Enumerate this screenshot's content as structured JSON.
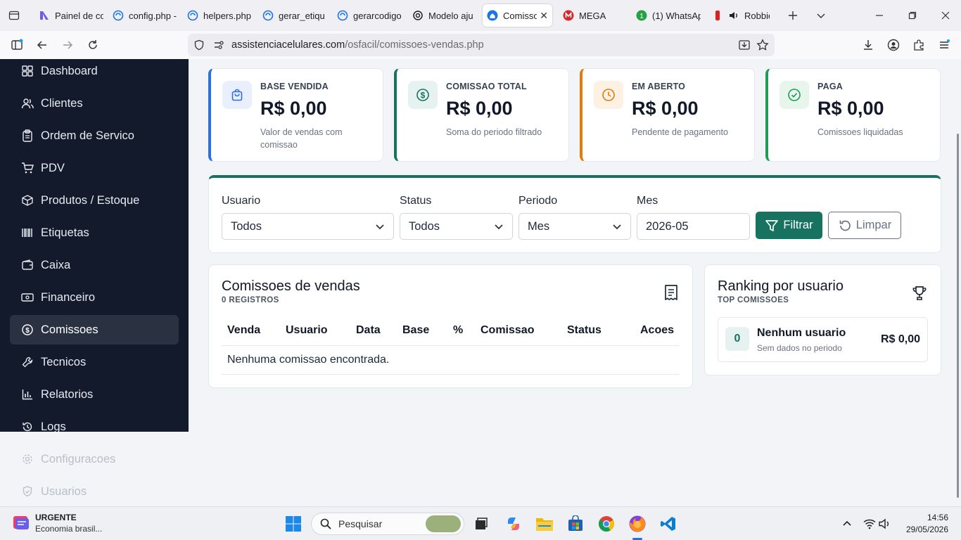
{
  "browser": {
    "tabs": [
      {
        "label": "Painel de co",
        "icon": "php-blue-icon"
      },
      {
        "label": "config.php -",
        "icon": "globe-icon"
      },
      {
        "label": "helpers.php",
        "icon": "globe-icon"
      },
      {
        "label": "gerar_etiqu",
        "icon": "globe-icon"
      },
      {
        "label": "gerarcodigo",
        "icon": "globe-icon"
      },
      {
        "label": "Modelo aju",
        "icon": "openai-icon"
      },
      {
        "label": "Comissoe",
        "icon": "home-icon"
      },
      {
        "label": "MEGA",
        "icon": "mega-icon"
      },
      {
        "label": "(1) WhatsAp",
        "icon": "whatsapp-icon"
      },
      {
        "label": "Robbie",
        "icon": "music-icon"
      }
    ],
    "url_host": "assistenciacelulares.com",
    "url_path": "/osfacil/comissoes-vendas.php"
  },
  "sidebar": {
    "items": [
      {
        "label": "Dashboard",
        "icon": "grid-icon"
      },
      {
        "label": "Clientes",
        "icon": "users-icon"
      },
      {
        "label": "Ordem de Servico",
        "icon": "clipboard-icon"
      },
      {
        "label": "PDV",
        "icon": "cart-icon"
      },
      {
        "label": "Produtos / Estoque",
        "icon": "box-icon"
      },
      {
        "label": "Etiquetas",
        "icon": "barcode-icon"
      },
      {
        "label": "Caixa",
        "icon": "wallet-icon"
      },
      {
        "label": "Financeiro",
        "icon": "cash-icon"
      },
      {
        "label": "Comissoes",
        "icon": "coin-icon",
        "active": true
      },
      {
        "label": "Tecnicos",
        "icon": "wrench-icon"
      },
      {
        "label": "Relatorios",
        "icon": "bar-chart-icon"
      },
      {
        "label": "Logs",
        "icon": "history-icon"
      }
    ],
    "overflow_items": [
      {
        "label": "Configuracoes",
        "icon": "gear-icon"
      },
      {
        "label": "Usuarios",
        "icon": "shield-icon"
      }
    ]
  },
  "stats": [
    {
      "title": "BASE VENDIDA",
      "value": "R$ 0,00",
      "subtitle": "Valor de vendas com comissao",
      "accent": "#2f6fe0",
      "icon": "bag-icon"
    },
    {
      "title": "COMISSAO TOTAL",
      "value": "R$ 0,00",
      "subtitle": "Soma do periodo filtrado",
      "accent": "#17725f",
      "icon": "coin-icon"
    },
    {
      "title": "EM ABERTO",
      "value": "R$ 0,00",
      "subtitle": "Pendente de pagamento",
      "accent": "#e07b12",
      "icon": "clock-icon"
    },
    {
      "title": "PAGA",
      "value": "R$ 0,00",
      "subtitle": "Comissoes liquidadas",
      "accent": "#1f9d55",
      "icon": "check-circle-icon"
    }
  ],
  "filters": {
    "usuario_label": "Usuario",
    "usuario_value": "Todos",
    "status_label": "Status",
    "status_value": "Todos",
    "periodo_label": "Periodo",
    "periodo_value": "Mes",
    "mes_label": "Mes",
    "mes_value": "2026-05",
    "filter_button": "Filtrar",
    "clear_button": "Limpar"
  },
  "commissions": {
    "title": "Comissoes de vendas",
    "subtitle": "0 REGISTROS",
    "columns": [
      "Venda",
      "Usuario",
      "Data",
      "Base",
      "%",
      "Comissao",
      "Status",
      "Acoes"
    ],
    "empty_message": "Nenhuma comissao encontrada."
  },
  "ranking": {
    "title": "Ranking por usuario",
    "subtitle": "TOP COMISSOES",
    "entry_count": "0",
    "entry_name": "Nenhum usuario",
    "entry_detail": "Sem dados no periodo",
    "entry_value": "R$ 0,00"
  },
  "taskbar": {
    "news_title": "URGENTE",
    "news_subtitle": "Economia brasil...",
    "search_placeholder": "Pesquisar",
    "time": "14:56",
    "date": "29/05/2026"
  },
  "colors": {
    "primary": "#17725f",
    "sidebar_bg": "#121a2c"
  }
}
